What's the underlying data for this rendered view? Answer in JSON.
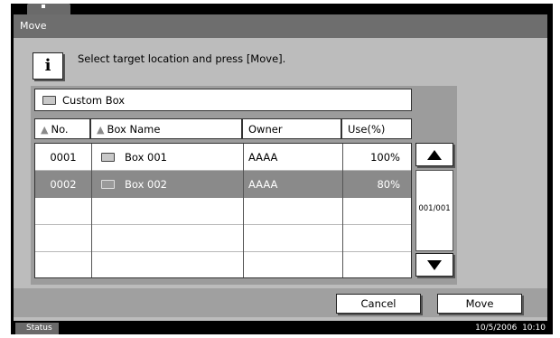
{
  "window": {
    "title": "Move"
  },
  "info": {
    "icon": "info-icon",
    "instruction": "Select target location and press [Move]."
  },
  "location": {
    "icon": "folder-icon",
    "path": "Custom Box"
  },
  "table": {
    "headers": {
      "no": "No.",
      "name": "Box Name",
      "owner": "Owner",
      "use": "Use(%)"
    },
    "sort_icon": "triangle-up-icon",
    "rows": [
      {
        "no": "0001",
        "name": "Box 001",
        "owner": "AAAA",
        "use": "100%",
        "selected": false
      },
      {
        "no": "0002",
        "name": "Box 002",
        "owner": "AAAA",
        "use": "80%",
        "selected": true
      }
    ]
  },
  "pager": {
    "page": "001/001",
    "up_icon": "arrow-up-icon",
    "down_icon": "arrow-down-icon"
  },
  "footer": {
    "cancel_label": "Cancel",
    "move_label": "Move"
  },
  "status": {
    "label": "Status",
    "date": "10/5/2006",
    "time": "10:10"
  },
  "colors": {
    "title_bar": "#6e6e6e",
    "panel": "#bcbcbc",
    "selected_row": "#8a8a8a",
    "frame": "#000000"
  }
}
